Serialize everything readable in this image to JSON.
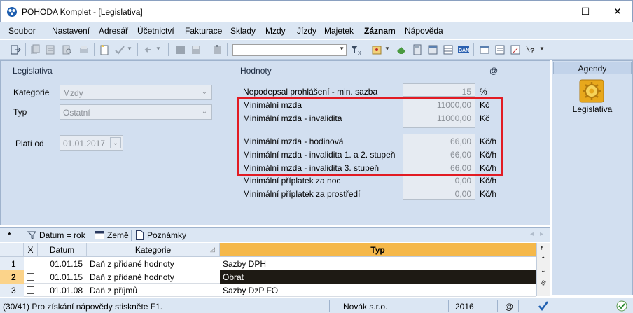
{
  "window": {
    "title": "POHODA Komplet - [Legislativa]",
    "min_label": "—",
    "max_label": "☐",
    "close_label": "✕"
  },
  "menu": [
    "Soubor",
    "Nastavení",
    "Adresář",
    "Účetnictví",
    "Fakturace",
    "Sklady",
    "Mzdy",
    "Jízdy",
    "Majetek",
    "Záznam",
    "Nápověda"
  ],
  "left": {
    "section_title": "Legislativa",
    "kategorie_label": "Kategorie",
    "kategorie_value": "Mzdy",
    "typ_label": "Typ",
    "typ_value": "Ostatní",
    "plati_od_label": "Platí od",
    "plati_od_value": "01.01.2017"
  },
  "right": {
    "section_title": "Hodnoty",
    "at_symbol": "@",
    "rows": [
      {
        "label": "Nepodepsal prohlášení - min. sazba",
        "value": "15",
        "unit": "%"
      },
      {
        "label": "Minimální mzda",
        "value": "11000,00",
        "unit": "Kč"
      },
      {
        "label": "Minimální mzda - invalidita",
        "value": "11000,00",
        "unit": "Kč"
      },
      {
        "label": "Minimální mzda - hodinová",
        "value": "66,00",
        "unit": "Kč/h"
      },
      {
        "label": "Minimální mzda - invalidita 1. a 2. stupeň",
        "value": "66,00",
        "unit": "Kč/h"
      },
      {
        "label": "Minimální mzda - invalidita 3. stupeň",
        "value": "66,00",
        "unit": "Kč/h"
      },
      {
        "label": "Minimální příplatek za noc",
        "value": "0,00",
        "unit": "Kč/h"
      },
      {
        "label": "Minimální příplatek za prostředí",
        "value": "0,00",
        "unit": "Kč/h"
      }
    ]
  },
  "agendy": {
    "header": "Agendy",
    "item_label": "Legislativa"
  },
  "tabs": {
    "star": "*",
    "filter": "Datum = rok",
    "zeme": "Země",
    "poznamky": "Poznámky"
  },
  "grid": {
    "headers": {
      "x": "X",
      "datum": "Datum",
      "kategorie": "Kategorie",
      "typ": "Typ"
    },
    "rows": [
      {
        "num": "1",
        "datum": "01.01.15",
        "kategorie": "Daň z přidané hodnoty",
        "typ": "Sazby DPH"
      },
      {
        "num": "2",
        "datum": "01.01.15",
        "kategorie": "Daň z přidané hodnoty",
        "typ": "Obrat"
      },
      {
        "num": "3",
        "datum": "01.01.08",
        "kategorie": "Daň z příjmů",
        "typ": "Sazby DzP FO"
      }
    ]
  },
  "status": {
    "help": "(30/41) Pro získání nápovědy stiskněte F1.",
    "company": "Novák s.r.o.",
    "year": "2016",
    "at": "@"
  },
  "colors": {
    "highlight_red": "#e21b23",
    "selected_row": "#fbd38a",
    "typ_header": "#f5b84a",
    "panel_bg": "#d2dff0"
  }
}
